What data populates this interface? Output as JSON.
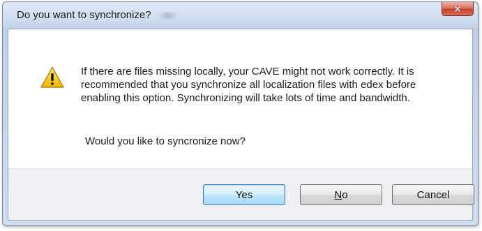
{
  "dialog": {
    "title": "Do you want to synchronize?",
    "close_glyph": "✕",
    "icon": "warning-triangle-icon",
    "message": "If there are files missing locally, your CAVE might not work correctly. It is recommended that you synchronize all localization files with edex before enabling this option. Synchronizing will take lots of time and bandwidth.",
    "question": "Would you like to syncronize now?"
  },
  "buttons": {
    "yes_label": "Yes",
    "no_label": "No",
    "cancel_label": "Cancel"
  },
  "colors": {
    "warning_fill": "#f5c400",
    "close_button": "#c4412a",
    "default_button_border": "#3c7fb1"
  }
}
